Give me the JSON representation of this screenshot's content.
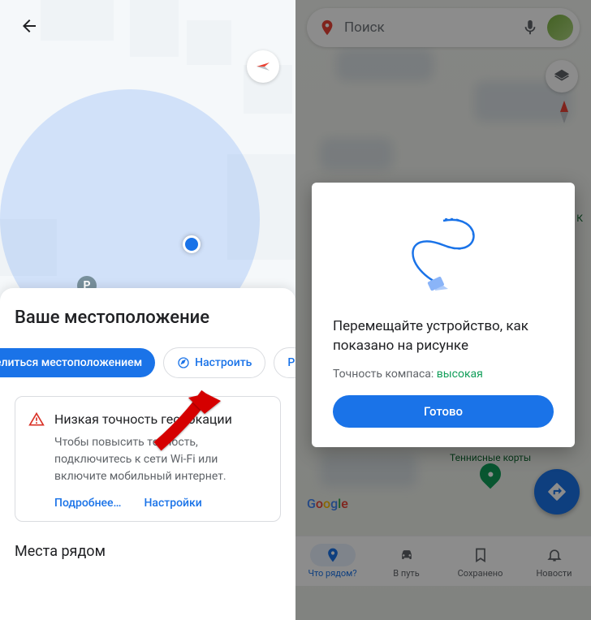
{
  "left": {
    "parking_glyph": "P",
    "compass_arrow": "➤",
    "sheet": {
      "title": "Ваше местоположение",
      "chip_share": "елиться местоположением",
      "chip_calibrate": "Настроить",
      "chip_extra": "P",
      "accuracy": {
        "warning_glyph": "⚠",
        "title": "Низкая точность геолокации",
        "body": "Чтобы повысить точность, подключитесь к сети Wi-Fi или включите мобильный интернет.",
        "more": "Подробнее…",
        "settings": "Настройки"
      },
      "nearby": "Места рядом"
    }
  },
  "right": {
    "search_placeholder": "Поиск",
    "poi_tennis": "Теннисные корты",
    "poi_letter": "К",
    "dialog": {
      "title": "Перемещайте устройство, как показано на рисунке",
      "accuracy_label": "Точность компаса: ",
      "accuracy_value": "высокая",
      "done": "Готово"
    },
    "nav": {
      "explore": "Что рядом?",
      "go": "В путь",
      "saved": "Сохранено",
      "updates": "Новости"
    }
  }
}
